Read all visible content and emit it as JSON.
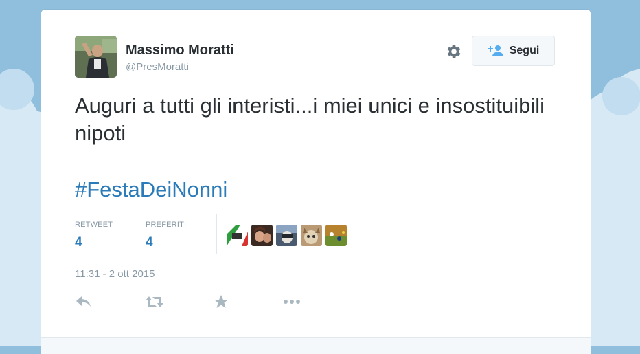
{
  "author": {
    "name": "Massimo Moratti",
    "handle": "@PresMoratti"
  },
  "follow_button": {
    "label": "Segui"
  },
  "tweet": {
    "text": "Auguri a tutti gli interisti...i miei unici e insostituibili nipoti",
    "hashtag": "#FestaDeiNonni"
  },
  "stats": {
    "retweet_label": "RETWEET",
    "retweet_count": "4",
    "favorites_label": "PREFERITI",
    "favorites_count": "4"
  },
  "timestamp": "11:31 - 2 ott 2015",
  "actions": [
    "reply-icon",
    "retweet-icon",
    "favorite-icon",
    "more-icon"
  ],
  "colors": {
    "background": "#8fbfdc",
    "link": "#2b7bb9",
    "text": "#292f33",
    "muted": "#8899a6",
    "border": "#e1e8ed"
  }
}
